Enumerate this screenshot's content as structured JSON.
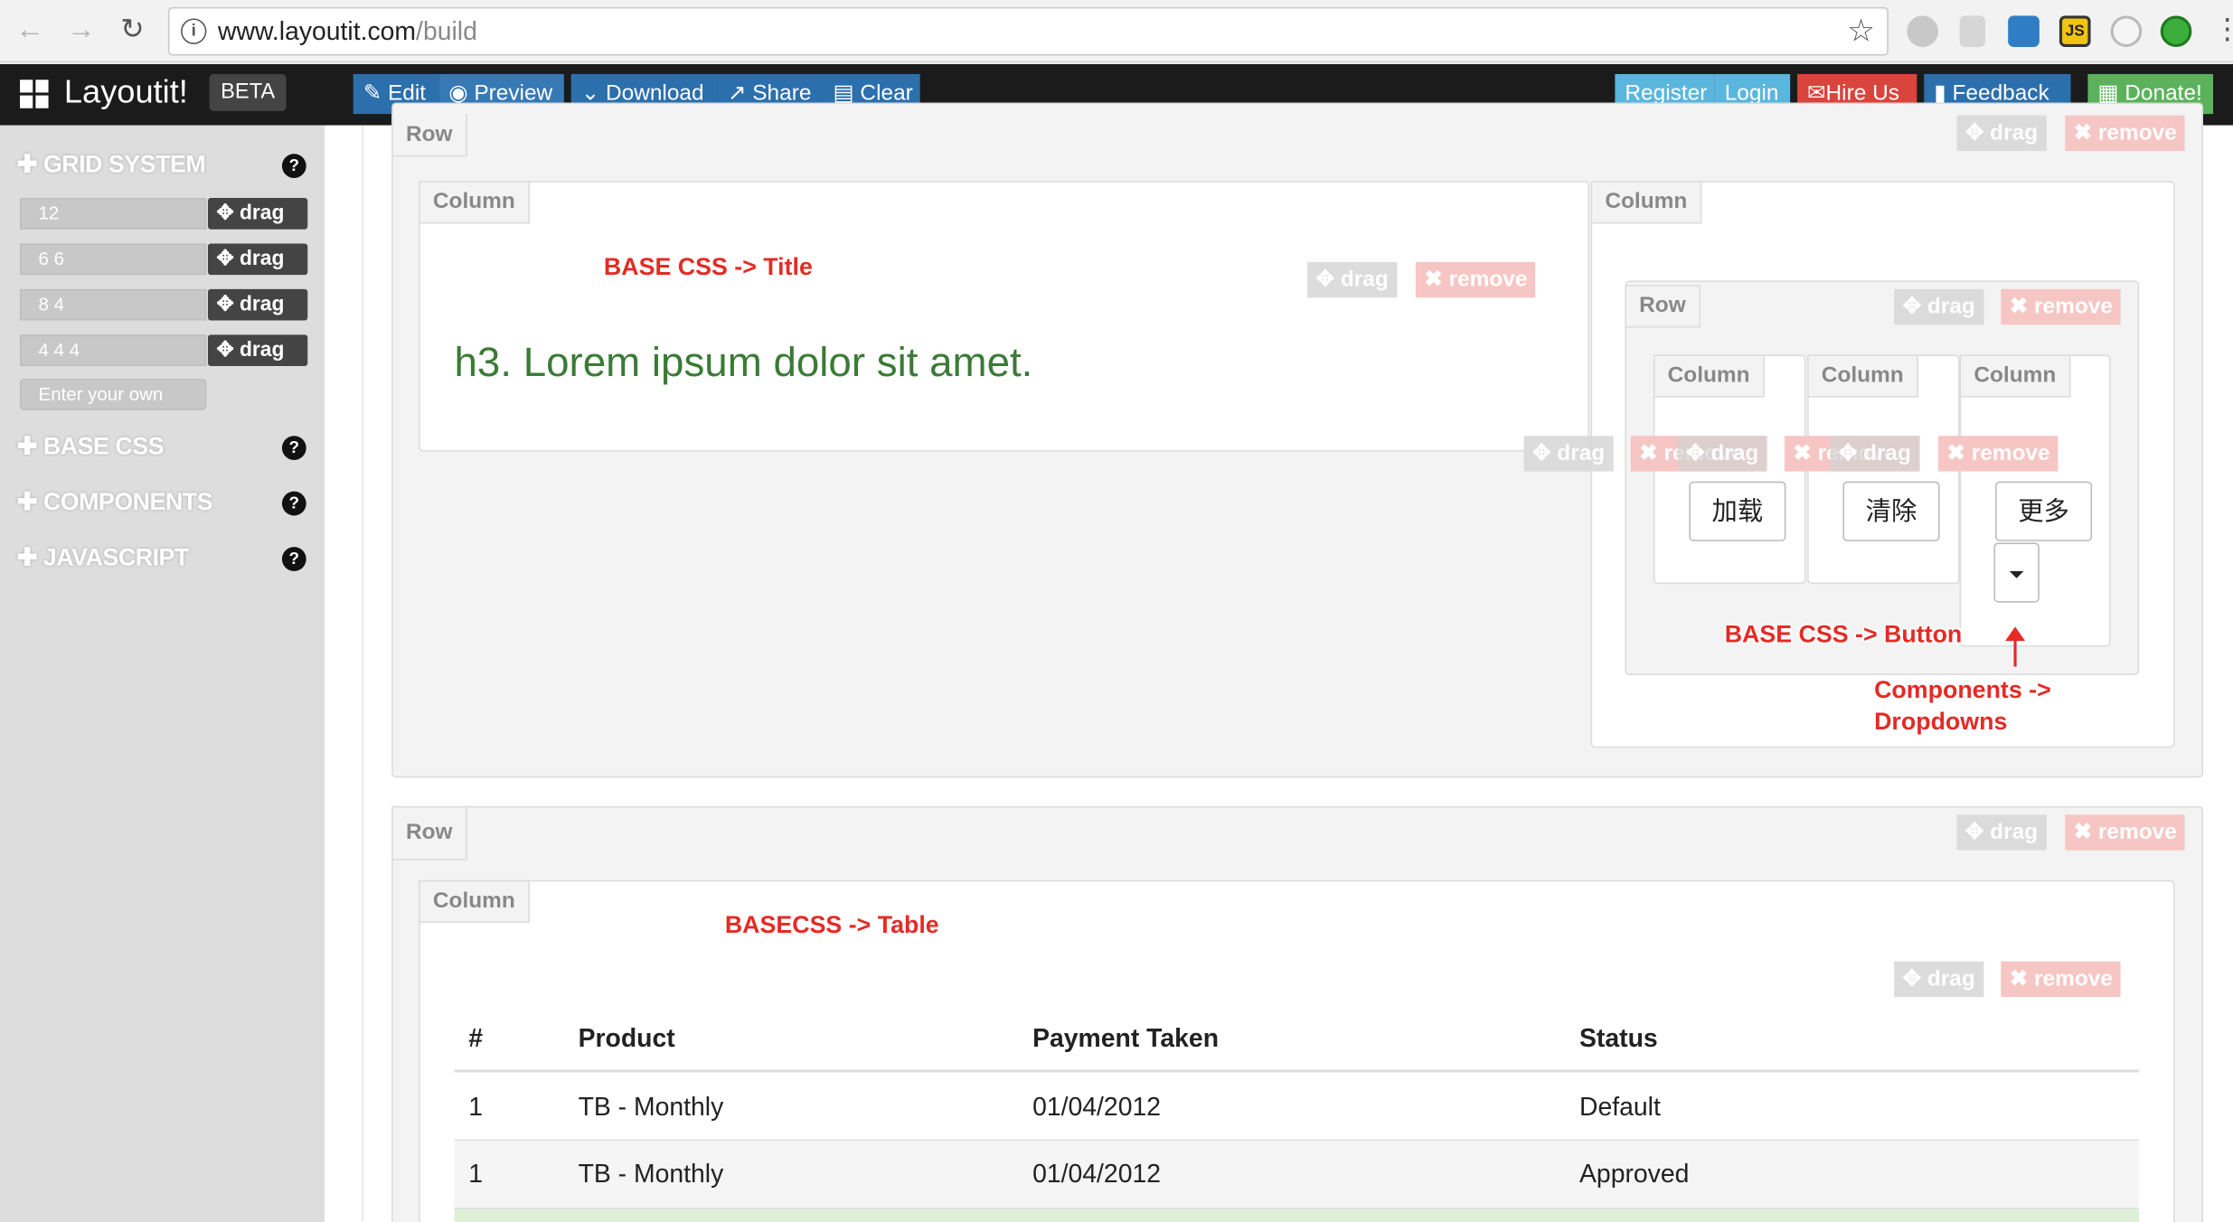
{
  "browser": {
    "url_host": "www.layoutit.com",
    "url_path": "/build"
  },
  "brand": {
    "name": "Layoutit!",
    "badge": "BETA"
  },
  "toolbar": {
    "edit": "Edit",
    "preview": "Preview",
    "download": "Download",
    "share": "Share",
    "clear": "Clear",
    "register": "Register",
    "login": "Login",
    "hire_us": "Hire Us",
    "feedback": "Feedback",
    "donate": "Donate!"
  },
  "sidebar": {
    "grid_title": "GRID SYSTEM",
    "grid_items": [
      {
        "value": "12",
        "drag": "drag"
      },
      {
        "value": "6 6",
        "drag": "drag"
      },
      {
        "value": "8 4",
        "drag": "drag"
      },
      {
        "value": "4 4 4",
        "drag": "drag"
      }
    ],
    "custom_placeholder": "Enter your own",
    "base_css": "BASE CSS",
    "components": "COMPONENTS",
    "javascript": "JAVASCRIPT"
  },
  "canvas": {
    "row_label": "Row",
    "column_label": "Column",
    "drag_label": "drag",
    "remove_label": "remove",
    "heading": "h3. Lorem ipsum dolor sit amet.",
    "buttons": [
      "加载",
      "清除",
      "更多"
    ]
  },
  "annotations": {
    "title": "BASE CSS -> Title",
    "button": "BASE CSS -> Button",
    "dropdowns_line1": "Components ->",
    "dropdowns_line2": "Dropdowns",
    "table": "BASECSS -> Table"
  },
  "table": {
    "headers": [
      "#",
      "Product",
      "Payment Taken",
      "Status"
    ],
    "rows": [
      [
        "1",
        "TB - Monthly",
        "01/04/2012",
        "Default"
      ],
      [
        "1",
        "TB - Monthly",
        "01/04/2012",
        "Approved"
      ]
    ]
  },
  "colors": {
    "navbar": "#1b1b1b",
    "primary_blue": "#2c6fad",
    "light_blue": "#5bb6de",
    "danger_red": "#d9443c",
    "success_green": "#5cb25c",
    "heading_green": "#3a7b36",
    "annotation_red": "#e42b25"
  }
}
